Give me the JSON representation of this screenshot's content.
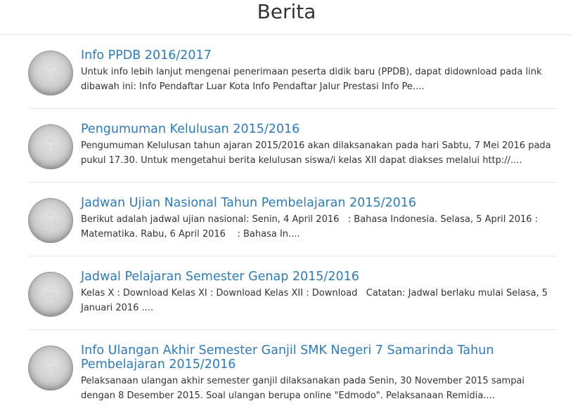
{
  "header": {
    "title": "Berita"
  },
  "thumbnail": {
    "line1": "NO",
    "line2": "IMAGE",
    "line3": "AVAILABLE"
  },
  "news": [
    {
      "title": "Info PPDB 2016/2017",
      "excerpt": "Untuk info lebih lanjut mengenai penerimaan peserta didik baru (PPDB), dapat didownload pada link dibawah ini: Info Pendaftar Luar Kota Info Pendaftar Jalur Prestasi Info Pe...."
    },
    {
      "title": "Pengumuman Kelulusan 2015/2016",
      "excerpt": "Pengumuman Kelulusan tahun ajaran 2015/2016 akan dilaksanakan pada hari Sabtu, 7 Mei 2016 pada pukul 17.30. Untuk mengetahui berita kelulusan siswa/i kelas XII dapat diakses melalui http://...."
    },
    {
      "title": "Jadwan Ujian Nasional Tahun Pembelajaran 2015/2016",
      "excerpt": "Berikut adalah jadwal ujian nasional: Senin, 4 April 2016   : Bahasa Indonesia. Selasa, 5 April 2016 : Matematika. Rabu, 6 April 2016    : Bahasa In...."
    },
    {
      "title": "Jadwal Pelajaran Semester Genap 2015/2016",
      "excerpt": "Kelas X : Download Kelas XI : Download Kelas XII : Download   Catatan: Jadwal berlaku mulai Selasa, 5 Januari 2016 ...."
    },
    {
      "title": "Info Ulangan Akhir Semester Ganjil SMK Negeri 7 Samarinda Tahun Pembelajaran 2015/2016",
      "excerpt": "Pelaksanaan ulangan akhir semester ganjil dilaksanakan pada Senin, 30 November 2015 sampai dengan 8 Desember 2015. Soal ulangan berupa online \"Edmodo\". Pelaksanaan Remidia...."
    }
  ]
}
